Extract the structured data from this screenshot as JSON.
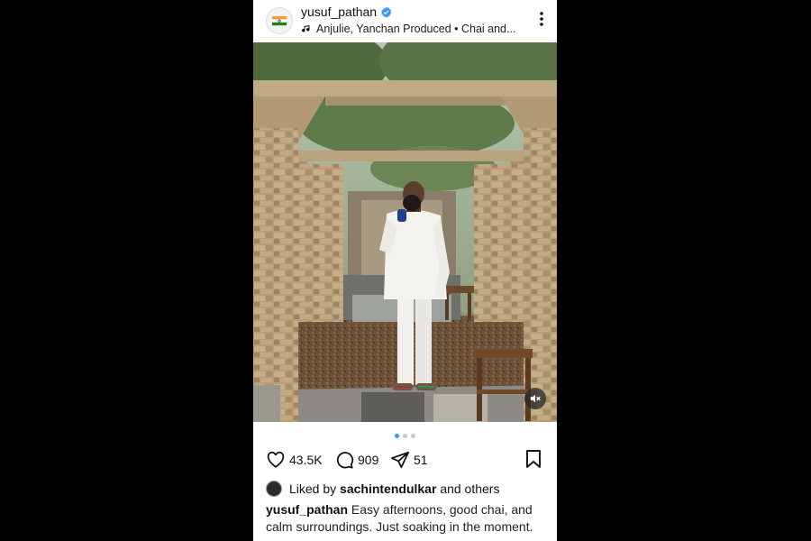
{
  "post": {
    "username": "yusuf_pathan",
    "audio": "Anjulie, Yanchan Produced • Chai and...",
    "likes": "43.5K",
    "comments": "909",
    "shares": "51",
    "liked_by_prefix": "Liked by",
    "liked_by_user": "sachintendulkar",
    "liked_by_suffix": "and others",
    "caption_user": "yusuf_pathan",
    "caption_text": "Easy afternoons, good chai, and calm surroundings. Just soaking in the moment.",
    "carousel_total": 3,
    "carousel_active": 1
  },
  "icons": {
    "verified": "verified-badge-icon",
    "music": "music-note-icon",
    "more": "more-options-icon",
    "like": "heart-icon",
    "comment": "comment-icon",
    "share": "send-icon",
    "save": "bookmark-icon",
    "mute": "muted-speaker-icon"
  },
  "colors": {
    "verified": "#3897f0",
    "active_dot": "#3897f0"
  }
}
